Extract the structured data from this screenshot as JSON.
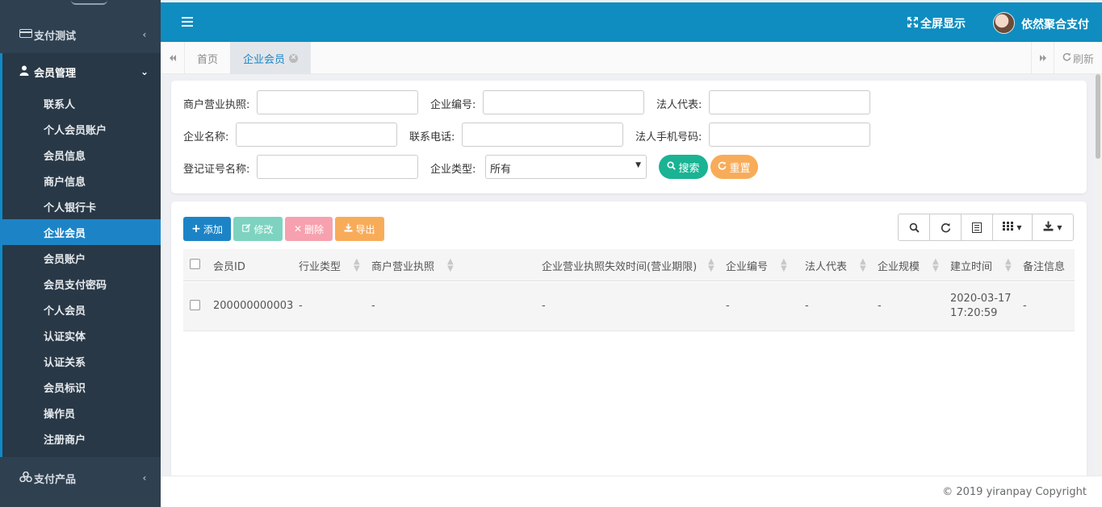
{
  "colors": {
    "sidebar_bg": "#2f4050",
    "topbar_bg": "#0f8dc0",
    "active_menu": "#1c84c6",
    "search_btn": "#1ab394",
    "reset_btn": "#f8ac59",
    "add_btn": "#1c84c6",
    "edit_btn": "#7dd3c0",
    "delete_btn": "#f7a1ae",
    "export_btn": "#f8ac59"
  },
  "sidebar": {
    "groups": [
      {
        "label": "支付测试",
        "icon": "credit-card-icon",
        "chevron": "‹"
      },
      {
        "label": "会员管理",
        "icon": "user-icon",
        "chevron": "⌄"
      },
      {
        "label": "支付产品",
        "icon": "cubes-icon",
        "chevron": "‹"
      }
    ],
    "items": [
      {
        "label": "联系人"
      },
      {
        "label": "个人会员账户"
      },
      {
        "label": "会员信息"
      },
      {
        "label": "商户信息"
      },
      {
        "label": "个人银行卡"
      },
      {
        "label": "企业会员"
      },
      {
        "label": "会员账户"
      },
      {
        "label": "会员支付密码"
      },
      {
        "label": "个人会员"
      },
      {
        "label": "认证实体"
      },
      {
        "label": "认证关系"
      },
      {
        "label": "会员标识"
      },
      {
        "label": "操作员"
      },
      {
        "label": "注册商户"
      }
    ]
  },
  "header": {
    "menu_icon": "hamburger-icon",
    "fullscreen_label": "全屏显示",
    "username": "依然聚合支付"
  },
  "tabs": {
    "home": "首页",
    "active": "企业会员",
    "refresh": "刷新"
  },
  "search": {
    "label_license": "商户营业执照:",
    "label_company_no": "企业编号:",
    "label_legal_rep": "法人代表:",
    "label_company_name": "企业名称:",
    "label_phone": "联系电话:",
    "label_legal_phone": "法人手机号码:",
    "label_reg_cert": "登记证号名称:",
    "label_company_type": "企业类型:",
    "company_type_value": "所有",
    "search_btn": "搜索",
    "reset_btn": "重置"
  },
  "toolbar": {
    "add": "添加",
    "edit": "修改",
    "delete": "删除",
    "export": "导出"
  },
  "table": {
    "columns": [
      "会员ID",
      "行业类型",
      "商户营业执照",
      "企业营业执照失效时间(营业期限)",
      "企业编号",
      "法人代表",
      "企业规模",
      "建立时间",
      "备注信息"
    ],
    "rows": [
      {
        "member_id": "200000000003",
        "industry": "-",
        "license": "-",
        "expiry": "-",
        "company_no": "-",
        "legal_rep": "-",
        "scale": "-",
        "created_date": "2020-03-17",
        "created_time": "17:20:59",
        "remark": "-"
      }
    ]
  },
  "footer": {
    "copyright": "© 2019 yiranpay Copyright"
  }
}
